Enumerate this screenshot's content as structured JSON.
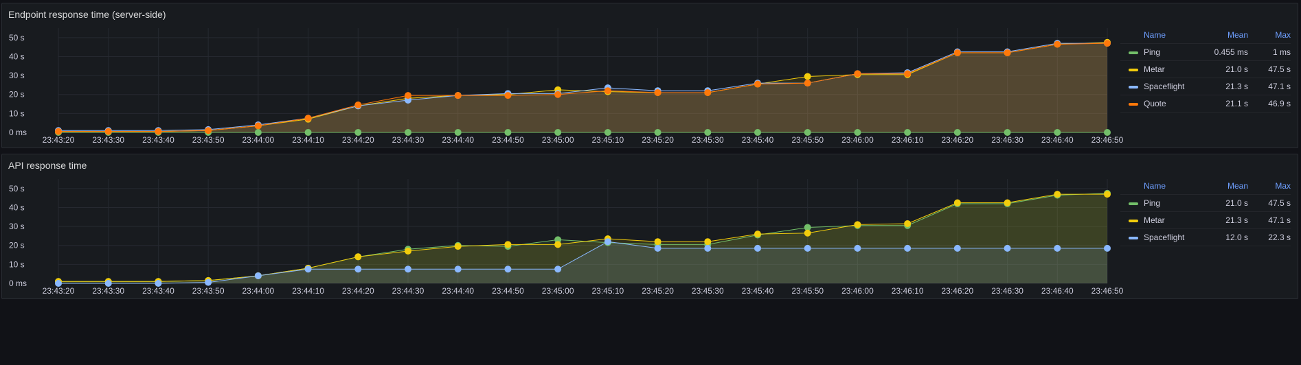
{
  "colors": {
    "green": "#73bf69",
    "yellow": "#f2cc0c",
    "blue": "#8ab8ff",
    "orange": "#ff780a"
  },
  "legend_headers": {
    "name": "Name",
    "mean": "Mean",
    "max": "Max"
  },
  "chart_data": [
    {
      "type": "line",
      "title": "Endpoint response time (server-side)",
      "x": [
        "23:43:20",
        "23:43:30",
        "23:43:40",
        "23:43:50",
        "23:44:00",
        "23:44:10",
        "23:44:20",
        "23:44:30",
        "23:44:40",
        "23:44:50",
        "23:45:00",
        "23:45:10",
        "23:45:20",
        "23:45:30",
        "23:45:40",
        "23:45:50",
        "23:46:00",
        "23:46:10",
        "23:46:20",
        "23:46:30",
        "23:46:40",
        "23:46:50"
      ],
      "yticks": [
        "0 ms",
        "10 s",
        "20 s",
        "30 s",
        "40 s",
        "50 s"
      ],
      "ylim": [
        0,
        55
      ],
      "fill_series": "Quote",
      "series": [
        {
          "name": "Ping",
          "color": "#73bf69",
          "mean": "0.455 ms",
          "max": "1 ms",
          "values": [
            0,
            0,
            0,
            0,
            0,
            0,
            0,
            0,
            0,
            0,
            0,
            0,
            0,
            0,
            0,
            0,
            0,
            0,
            0,
            0,
            0,
            0
          ]
        },
        {
          "name": "Metar",
          "color": "#f2cc0c",
          "mean": "21.0 s",
          "max": "47.5 s",
          "values": [
            0.5,
            0.5,
            0.5,
            1,
            3.5,
            7,
            14,
            18,
            19.5,
            20,
            22.5,
            21.5,
            21,
            21,
            25.5,
            29.5,
            30.5,
            30.5,
            42,
            42,
            46.5,
            47.5
          ]
        },
        {
          "name": "Spaceflight",
          "color": "#8ab8ff",
          "mean": "21.3 s",
          "max": "47.1 s",
          "values": [
            1,
            1,
            1,
            1.5,
            4,
            7.5,
            14,
            17,
            19.5,
            20.5,
            20.5,
            23.5,
            22,
            22,
            26,
            26,
            31,
            31.5,
            42.5,
            42.5,
            47,
            47
          ]
        },
        {
          "name": "Quote",
          "color": "#ff780a",
          "mean": "21.1 s",
          "max": "46.9 s",
          "values": [
            0.5,
            0.5,
            0.5,
            1,
            3.5,
            7.5,
            14.5,
            19.5,
            19.5,
            19.5,
            20,
            22,
            21,
            21,
            25.5,
            26,
            31,
            31,
            42,
            42,
            46.5,
            47
          ]
        }
      ]
    },
    {
      "type": "line",
      "title": "API response time",
      "x": [
        "23:43:20",
        "23:43:30",
        "23:43:40",
        "23:43:50",
        "23:44:00",
        "23:44:10",
        "23:44:20",
        "23:44:30",
        "23:44:40",
        "23:44:50",
        "23:45:00",
        "23:45:10",
        "23:45:20",
        "23:45:30",
        "23:45:40",
        "23:45:50",
        "23:46:00",
        "23:46:10",
        "23:46:20",
        "23:46:30",
        "23:46:40",
        "23:46:50"
      ],
      "yticks": [
        "0 ms",
        "10 s",
        "20 s",
        "30 s",
        "40 s",
        "50 s"
      ],
      "ylim": [
        0,
        55
      ],
      "fill_series": "Metar",
      "series": [
        {
          "name": "Ping",
          "color": "#73bf69",
          "mean": "21.0 s",
          "max": "47.5 s",
          "values": [
            1,
            1,
            1,
            1.5,
            4,
            8,
            14,
            18,
            20,
            19.5,
            23,
            21.5,
            20.5,
            20.5,
            25.5,
            29.5,
            30.5,
            30.5,
            42,
            42,
            46.5,
            47.5
          ]
        },
        {
          "name": "Metar",
          "color": "#f2cc0c",
          "mean": "21.3 s",
          "max": "47.1 s",
          "values": [
            1,
            1,
            1,
            1.5,
            4,
            8,
            14,
            17,
            19.5,
            20.5,
            20.5,
            23.5,
            22,
            22,
            26,
            26.5,
            31,
            31.5,
            42.5,
            42.5,
            47,
            47
          ]
        },
        {
          "name": "Spaceflight",
          "color": "#8ab8ff",
          "mean": "12.0 s",
          "max": "22.3 s",
          "values": [
            0,
            0,
            0,
            0.5,
            4,
            7.5,
            7.5,
            7.5,
            7.5,
            7.5,
            7.5,
            22,
            18.5,
            18.5,
            18.5,
            18.5,
            18.5,
            18.5,
            18.5,
            18.5,
            18.5,
            18.5
          ]
        }
      ]
    }
  ]
}
